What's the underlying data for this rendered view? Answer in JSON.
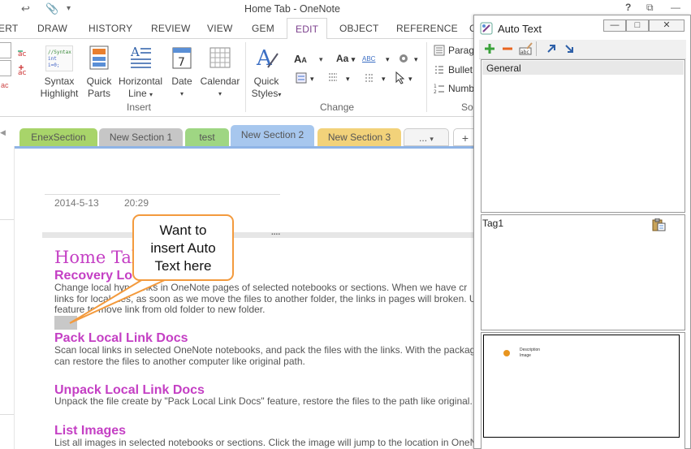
{
  "window": {
    "title": "Home Tab - OneNote",
    "help": "?",
    "restore": "⧉",
    "minimize": "—"
  },
  "quickaccess": {
    "back": "↩",
    "attach": "📎",
    "more": "▾"
  },
  "tabs": [
    "ERT",
    "DRAW",
    "HISTORY",
    "REVIEW",
    "VIEW",
    "GEM",
    "EDIT",
    "OBJECT",
    "REFERENCE",
    "C"
  ],
  "ribbon": {
    "syntax": {
      "line1": "Syntax",
      "line2": "Highlight",
      "code1": "//Syntax",
      "code2": "int i=0;"
    },
    "quickparts": {
      "line1": "Quick",
      "line2": "Parts"
    },
    "horizline": {
      "line1": "Horizontal",
      "line2": "Line"
    },
    "date": {
      "line1": "Date"
    },
    "calendar": {
      "line1": "Calendar"
    },
    "insert_group": "Insert",
    "quickstyles": {
      "line1": "Quick",
      "line2": "Styles"
    },
    "change_group": "Change",
    "font_grow": "A",
    "font_aa": "Aa",
    "abc": "ABC",
    "right": {
      "item1": "Parag",
      "item2": "Bullet",
      "item3": "Numb",
      "group": "So"
    }
  },
  "sections": [
    {
      "label": "EnexSection",
      "color": "#a8d46a"
    },
    {
      "label": "New Section 1",
      "color": "#c6c6c6"
    },
    {
      "label": "test",
      "color": "#9fd683"
    },
    {
      "label": "New Section 2",
      "color": "#a7c7ee"
    },
    {
      "label": "New Section 3",
      "color": "#f2d27a"
    },
    {
      "label": "...",
      "color": "#f4f4f4"
    },
    {
      "label": "+",
      "color": "#ffffff"
    }
  ],
  "page": {
    "date": "2014-5-13",
    "time": "20:29",
    "outline_handle": "....",
    "title": "Home Tab",
    "items": [
      {
        "heading": "Recovery Lo",
        "text": [
          "Change local hyperlinks in OneNote pages of selected notebooks or sections. When we have cr",
          "links for local files, as soon as we move the files to another folder, the links in pages will broken. U",
          "feature to move link from old folder to new folder."
        ]
      },
      {
        "heading": "Pack Local Link Docs",
        "text": [
          "Scan local links in selected OneNote notebooks, and pack the files with the links. With the packag",
          "can restore the files to another computer like original path."
        ]
      },
      {
        "heading": "Unpack Local Link Docs",
        "text": [
          "Unpack the file create by \"Pack Local Link Docs\" feature, restore the files to the path like original."
        ]
      },
      {
        "heading": "List Images",
        "text": [
          "List all images in selected notebooks or sections. Click the image will jump to the location in OneN"
        ]
      }
    ]
  },
  "callout": {
    "line1": "Want to",
    "line2": "insert Auto",
    "line3": "Text here"
  },
  "panel": {
    "title": "Auto Text",
    "minimize": "—",
    "restore": "□",
    "close": "✕",
    "list_items": [
      "General"
    ],
    "tag": "Tag1",
    "preview_lines": [
      "Description",
      "Image"
    ]
  }
}
